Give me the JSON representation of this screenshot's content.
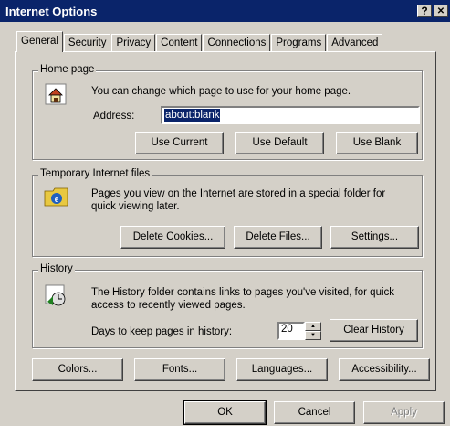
{
  "window": {
    "title": "Internet Options",
    "help_label": "?",
    "close_label": "✕"
  },
  "tabs": [
    {
      "label": "General",
      "active": true
    },
    {
      "label": "Security"
    },
    {
      "label": "Privacy"
    },
    {
      "label": "Content"
    },
    {
      "label": "Connections"
    },
    {
      "label": "Programs"
    },
    {
      "label": "Advanced"
    }
  ],
  "home_page": {
    "legend": "Home page",
    "description": "You can change which page to use for your home page.",
    "address_label": "Address:",
    "address_value": "about:blank",
    "use_current": "Use Current",
    "use_default": "Use Default",
    "use_blank": "Use Blank"
  },
  "temp_files": {
    "legend": "Temporary Internet files",
    "description_line1": "Pages you view on the Internet are stored in a special folder for",
    "description_line2": "quick viewing later.",
    "delete_cookies": "Delete Cookies...",
    "delete_files": "Delete Files...",
    "settings": "Settings..."
  },
  "history": {
    "legend": "History",
    "description_line1": "The History folder contains links to pages you've visited, for quick",
    "description_line2": "access to recently viewed pages.",
    "days_label": "Days to keep pages in history:",
    "days_value": "20",
    "clear_history": "Clear History"
  },
  "bottom_buttons": {
    "colors": "Colors...",
    "fonts": "Fonts...",
    "languages": "Languages...",
    "accessibility": "Accessibility..."
  },
  "dialog_buttons": {
    "ok": "OK",
    "cancel": "Cancel",
    "apply": "Apply"
  }
}
